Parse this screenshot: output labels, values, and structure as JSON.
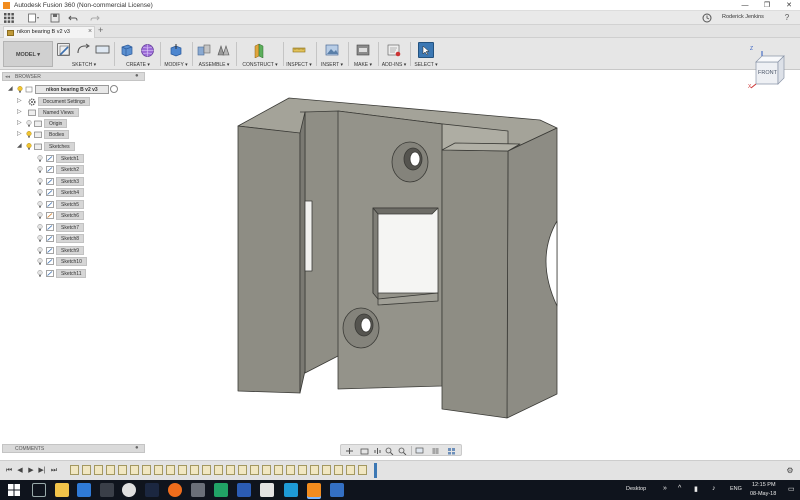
{
  "window": {
    "title": "Autodesk Fusion 360 (Non-commercial License)",
    "controls": [
      "—",
      "❐",
      "✕"
    ]
  },
  "quick_access": {
    "user": "Roderick Jenkins",
    "help": "?"
  },
  "tabs": {
    "document": "nikon bearing B v2 v3",
    "add": "+"
  },
  "ribbon": {
    "workspace": "MODEL ▾",
    "groups": [
      {
        "label": "SKETCH ▾",
        "icons": [
          "sketch-icon",
          "arc-icon",
          "rectangle-icon"
        ]
      },
      {
        "label": "CREATE ▾",
        "icons": [
          "box-icon",
          "sphere-icon"
        ]
      },
      {
        "label": "MODIFY ▾",
        "icons": [
          "press-pull-icon"
        ]
      },
      {
        "label": "ASSEMBLE ▾",
        "icons": [
          "joint-icon",
          "as-built-joint-icon"
        ]
      },
      {
        "label": "CONSTRUCT ▾",
        "icons": [
          "plane-icon"
        ]
      },
      {
        "label": "INSPECT ▾",
        "icons": [
          "measure-icon"
        ]
      },
      {
        "label": "INSERT ▾",
        "icons": [
          "insert-image-icon"
        ]
      },
      {
        "label": "MAKE ▾",
        "icons": [
          "3d-print-icon"
        ]
      },
      {
        "label": "ADD-INS ▾",
        "icons": [
          "scripts-icon"
        ]
      },
      {
        "label": "SELECT ▾",
        "icons": [
          "select-arrow-icon"
        ]
      }
    ]
  },
  "viewcube": {
    "label": "FRONT",
    "axis_z": "Z",
    "axis_x": "X"
  },
  "browser": {
    "header": "BROWSER",
    "root": "nikon bearing B v2 v3",
    "items": [
      {
        "label": "Document Settings",
        "icon": "gear-icon"
      },
      {
        "label": "Named Views",
        "icon": "folder-icon"
      },
      {
        "label": "Origin",
        "icon": "folder-icon"
      },
      {
        "label": "Bodies",
        "icon": "folder-icon"
      },
      {
        "label": "Sketches",
        "icon": "folder-icon"
      }
    ],
    "sketches": [
      "Sketch1",
      "Sketch2",
      "Sketch3",
      "Sketch4",
      "Sketch5",
      "Sketch6",
      "Sketch7",
      "Sketch8",
      "Sketch9",
      "Sketch10",
      "Sketch11"
    ]
  },
  "comments": {
    "label": "COMMENTS"
  },
  "navbar": {
    "icons": [
      "orbit-icon",
      "look-at-icon",
      "pan-icon",
      "zoom-icon",
      "fit-icon",
      "display-settings-icon",
      "grid-icon",
      "viewports-icon"
    ]
  },
  "timeline": {
    "controls": [
      "⏮",
      "◀",
      "▶",
      "▶|",
      "⏭"
    ],
    "feature_count": 25,
    "settings": "⚙"
  },
  "taskbar": {
    "tray_label": "Desktop",
    "lang": "ENG",
    "time": "12:15 PM",
    "date": "08-May-18"
  },
  "colors": {
    "model_face": "#8f8e85",
    "model_light": "#a4a399",
    "model_dark": "#6e6d66",
    "accent_select": "#3c78b4",
    "taskbar": "#0f141d"
  }
}
